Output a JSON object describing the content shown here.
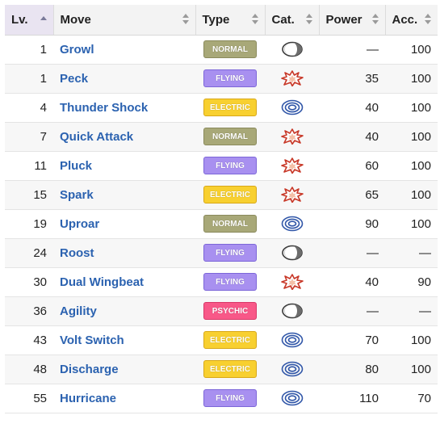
{
  "headers": {
    "lv": "Lv.",
    "move": "Move",
    "type": "Type",
    "cat": "Cat.",
    "power": "Power",
    "acc": "Acc."
  },
  "type_colors": {
    "NORMAL": {
      "bg": "#a8a878",
      "border": "#8a8a5c"
    },
    "FLYING": {
      "bg": "#a890f0",
      "border": "#7c66d8"
    },
    "ELECTRIC": {
      "bg": "#f8d030",
      "border": "#d8a818"
    },
    "PSYCHIC": {
      "bg": "#f85888",
      "border": "#d83868"
    }
  },
  "category_icons": {
    "status": "status-icon",
    "physical": "physical-icon",
    "special": "special-icon"
  },
  "rows": [
    {
      "lv": "1",
      "move": "Growl",
      "type": "NORMAL",
      "cat": "status",
      "power": "—",
      "acc": "100"
    },
    {
      "lv": "1",
      "move": "Peck",
      "type": "FLYING",
      "cat": "physical",
      "power": "35",
      "acc": "100"
    },
    {
      "lv": "4",
      "move": "Thunder Shock",
      "type": "ELECTRIC",
      "cat": "special",
      "power": "40",
      "acc": "100"
    },
    {
      "lv": "7",
      "move": "Quick Attack",
      "type": "NORMAL",
      "cat": "physical",
      "power": "40",
      "acc": "100"
    },
    {
      "lv": "11",
      "move": "Pluck",
      "type": "FLYING",
      "cat": "physical",
      "power": "60",
      "acc": "100"
    },
    {
      "lv": "15",
      "move": "Spark",
      "type": "ELECTRIC",
      "cat": "physical",
      "power": "65",
      "acc": "100"
    },
    {
      "lv": "19",
      "move": "Uproar",
      "type": "NORMAL",
      "cat": "special",
      "power": "90",
      "acc": "100"
    },
    {
      "lv": "24",
      "move": "Roost",
      "type": "FLYING",
      "cat": "status",
      "power": "—",
      "acc": "—"
    },
    {
      "lv": "30",
      "move": "Dual Wingbeat",
      "type": "FLYING",
      "cat": "physical",
      "power": "40",
      "acc": "90"
    },
    {
      "lv": "36",
      "move": "Agility",
      "type": "PSYCHIC",
      "cat": "status",
      "power": "—",
      "acc": "—"
    },
    {
      "lv": "43",
      "move": "Volt Switch",
      "type": "ELECTRIC",
      "cat": "special",
      "power": "70",
      "acc": "100"
    },
    {
      "lv": "48",
      "move": "Discharge",
      "type": "ELECTRIC",
      "cat": "special",
      "power": "80",
      "acc": "100"
    },
    {
      "lv": "55",
      "move": "Hurricane",
      "type": "FLYING",
      "cat": "special",
      "power": "110",
      "acc": "70"
    }
  ]
}
